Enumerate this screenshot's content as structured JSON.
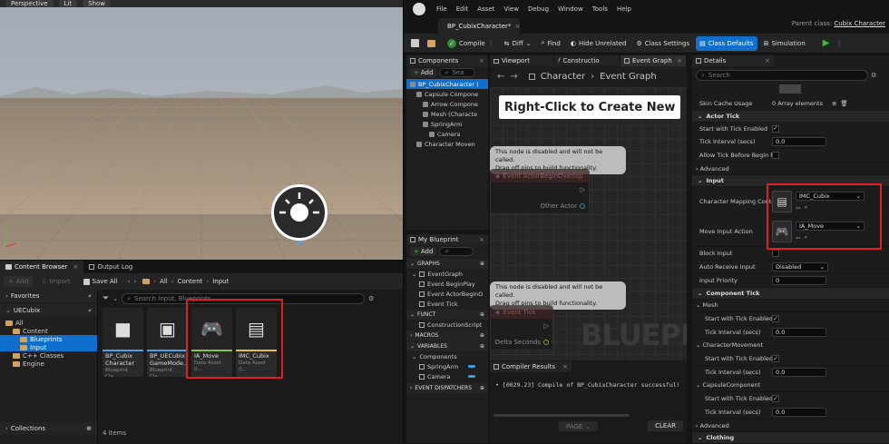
{
  "viewport": {
    "perspective_label": "Perspective",
    "lit_label": "Lit",
    "show_label": "Show"
  },
  "content_browser": {
    "tab_label": "Content Browser",
    "output_log_label": "Output Log",
    "add_label": "Add",
    "import_label": "Import",
    "save_all_label": "Save All",
    "breadcrumb": [
      "All",
      "Content",
      "Input"
    ],
    "favorites_label": "Favorites",
    "project_label": "UECubix",
    "tree": [
      {
        "label": "All",
        "depth": 0,
        "selected": false
      },
      {
        "label": "Content",
        "depth": 1,
        "selected": false
      },
      {
        "label": "Blueprints",
        "depth": 2,
        "selected": true
      },
      {
        "label": "Input",
        "depth": 2,
        "selected": true
      },
      {
        "label": "C++ Classes",
        "depth": 1,
        "selected": false
      },
      {
        "label": "Engine",
        "depth": 1,
        "selected": false
      }
    ],
    "search_placeholder": "Search Input, Blueprints",
    "assets": [
      {
        "name": "BP_Cubix Character",
        "type": "Blueprint Cla...",
        "stripe": "#4ea0e6"
      },
      {
        "name": "BP_UECubix GameMode...",
        "type": "Blueprint Cla...",
        "stripe": "#4ea0e6"
      },
      {
        "name": "IA_Move",
        "type": "Data Asset (I...",
        "stripe": "#8bc34a"
      },
      {
        "name": "IMC_Cubix",
        "type": "Data Asset (I...",
        "stripe": "#e0c040"
      }
    ],
    "item_count": "4 items",
    "collections_label": "Collections"
  },
  "editor": {
    "menu": [
      "File",
      "Edit",
      "Asset",
      "View",
      "Debug",
      "Window",
      "Tools",
      "Help"
    ],
    "doc_tab": "BP_CubixCharacter*",
    "parent_class_label": "Parent class:",
    "parent_class_value": "Cubix Character",
    "toolbar": {
      "compile": "Compile",
      "diff": "Diff",
      "find": "Find",
      "hide_unrelated": "Hide Unrelated",
      "class_settings": "Class Settings",
      "class_defaults": "Class Defaults",
      "simulation": "Simulation"
    },
    "components": {
      "tab_label": "Components",
      "add_label": "Add",
      "search_placeholder": "Sea",
      "items": [
        {
          "label": "BP_CubixCharacter (",
          "indent": 0,
          "selected": true
        },
        {
          "label": "Capsule Compone",
          "indent": 1,
          "selected": false
        },
        {
          "label": "Arrow Compone",
          "indent": 2,
          "selected": false
        },
        {
          "label": "Mesh (Characte",
          "indent": 2,
          "selected": false
        },
        {
          "label": "SpringArm",
          "indent": 2,
          "selected": false
        },
        {
          "label": "Camera",
          "indent": 3,
          "selected": false
        },
        {
          "label": "Character Moven",
          "indent": 1,
          "selected": false
        }
      ]
    },
    "my_blueprint": {
      "tab_label": "My Blueprint",
      "add_label": "Add",
      "graphs_label": "GRAPHS",
      "event_graph_label": "EventGraph",
      "graph_items": [
        "Event BeginPlay",
        "Event ActorBeginO",
        "Event Tick"
      ],
      "functions_label": "FUNCT",
      "function_items": [
        "ConstructionScript"
      ],
      "macros_label": "MACROS",
      "variables_label": "VARIABLES",
      "components_label": "Components",
      "variable_items": [
        "SpringArm",
        "Camera"
      ],
      "dispatchers_label": "EVENT DISPATCHERS"
    },
    "graph": {
      "tabs": [
        "Viewport",
        "Constructio",
        "Event Graph"
      ],
      "breadcrumb_root": "Character",
      "breadcrumb_leaf": "Event Graph",
      "hint": "Right-Click to Create New N",
      "disabled_note": "This node is disabled and will not be called.\nDrag off pins to build functionality.",
      "node1_title": "Event ActorBeginOverlap",
      "node1_pin": "Other Actor",
      "node2_title": "Event Tick",
      "node2_pin": "Delta Seconds",
      "watermark": "BLUEPRINT"
    },
    "compiler": {
      "tab_label": "Compiler Results",
      "message": "[0029.23] Compile of BP_CubixCharacter successful!",
      "page_label": "PAGE",
      "clear_label": "CLEAR"
    },
    "details": {
      "tab_label": "Details",
      "search_placeholder": "Search",
      "skin_cache_label": "Skin Cache Usage",
      "skin_cache_value": "0 Array elements",
      "actor_tick_label": "Actor Tick",
      "start_tick_label": "Start with Tick Enabled",
      "tick_interval_label": "Tick Interval (secs)",
      "tick_interval_value": "0.0",
      "allow_tick_label": "Allow Tick Before Begin Play",
      "advanced_label": "Advanced",
      "input_label": "Input",
      "mapping_label": "Character Mapping Contex",
      "mapping_value": "IMC_Cubix",
      "move_action_label": "Move Input Action",
      "move_action_value": "IA_Move",
      "block_input_label": "Block Input",
      "auto_receive_label": "Auto Receive Input",
      "auto_receive_value": "Disabled",
      "input_priority_label": "Input Priority",
      "input_priority_value": "0",
      "component_tick_label": "Component Tick",
      "mesh_label": "Mesh",
      "charmove_label": "CharacterMovement",
      "capsule_label": "CapsuleComponent",
      "clothing_label": "Clothing"
    }
  }
}
